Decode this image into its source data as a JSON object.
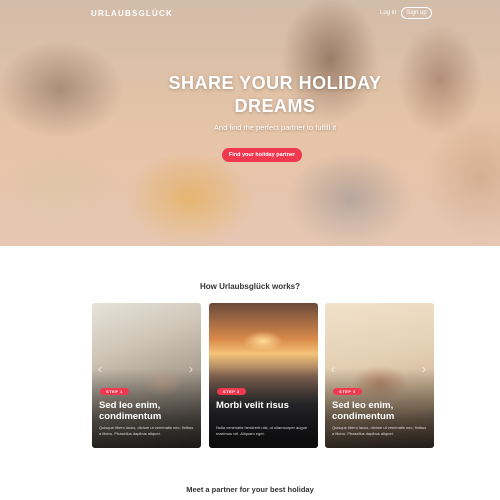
{
  "header": {
    "logo": "URLAUBSGLÜCK",
    "login_label": "Log in",
    "signup_label": "Sign up"
  },
  "hero": {
    "title": "SHARE YOUR HOLIDAY DREAMS",
    "subtitle": "And find the perfect partner to fulfill it",
    "cta_label": "Find your holiday partner"
  },
  "how": {
    "title": "How Urlaubsglück works?",
    "cards": [
      {
        "step": "STEP 1",
        "title": "Sed leo enim, condimentum",
        "text": "Quisque libero lacus, dictum ut venenatis nec, finibus a libero. Phasellus dapibus aliquet."
      },
      {
        "step": "STEP 2",
        "title": "Morbi velit risus",
        "text": "Nulla venenatis hendrerit nisl, ut ullamcorper augue maximus vel. Aliquam eget."
      },
      {
        "step": "STEP 3",
        "title": "Sed leo enim, condimentum",
        "text": "Quisque libero lacus, dictum ut venenatis nec, finibus a libero. Phasellus dapibus aliquet."
      }
    ]
  },
  "meet": {
    "title": "Meet a partner for your best holiday"
  },
  "colors": {
    "accent": "#f0384f"
  }
}
